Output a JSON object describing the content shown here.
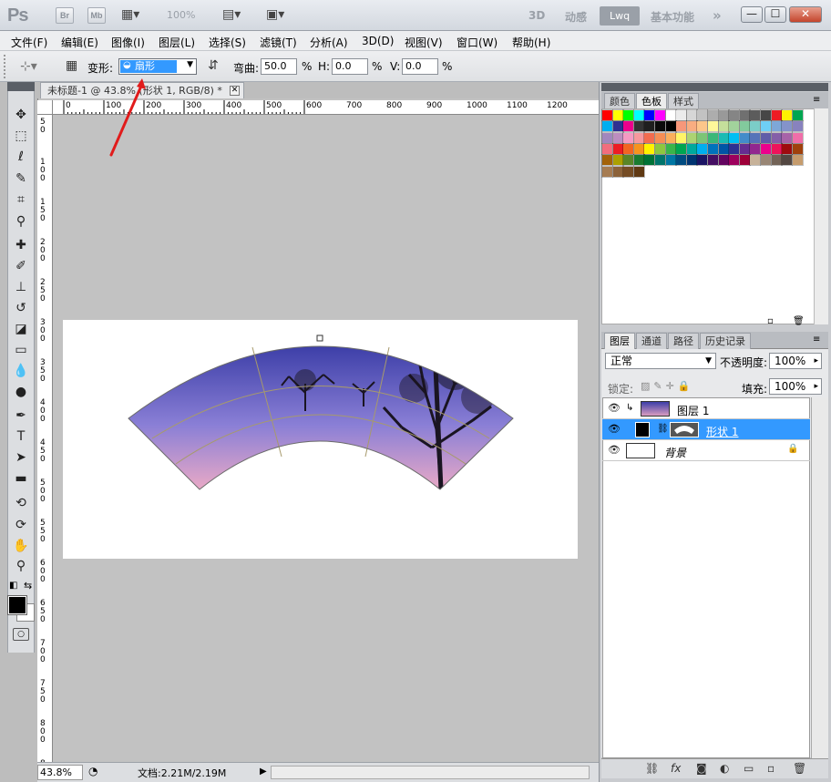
{
  "app": {
    "logo": "Ps",
    "bridge_label": "Br",
    "minibridge_label": "Mb",
    "zoom_text": "100%",
    "workspaces": [
      "3D",
      "动感",
      "Lwq",
      "基本功能"
    ],
    "more_glyph": "»",
    "minimize": "—",
    "maximize": "☐",
    "close": "✕"
  },
  "menu": [
    "文件(F)",
    "编辑(E)",
    "图像(I)",
    "图层(L)",
    "选择(S)",
    "滤镜(T)",
    "分析(A)",
    "3D(D)",
    "视图(V)",
    "窗口(W)",
    "帮助(H)"
  ],
  "options": {
    "warp_label": "变形:",
    "warp_value": "扇形",
    "bend_label": "弯曲:",
    "bend_value": "50.0",
    "bend_unit": "%",
    "h_label": "H:",
    "h_value": "0.0",
    "h_unit": "%",
    "v_label": "V:",
    "v_value": "0.0",
    "v_unit": "%"
  },
  "document": {
    "tab_title": "未标题-1 @ 43.8% (形状 1, RGB/8) *",
    "ruler_h": [
      "0",
      "100",
      "200",
      "300",
      "400",
      "500",
      "600",
      "700",
      "800",
      "900",
      "1000",
      "1100",
      "1200"
    ],
    "ruler_v": [
      "5\n0",
      "1\n0\n0",
      "1\n5\n0",
      "2\n0\n0",
      "2\n5\n0",
      "3\n0\n0",
      "3\n5\n0",
      "4\n0\n0",
      "4\n5\n0",
      "5\n0\n0",
      "5\n5\n0",
      "6\n0\n0",
      "6\n5\n0",
      "7\n0\n0",
      "7\n5\n0",
      "8\n0\n0",
      "8\n5\n0"
    ]
  },
  "status": {
    "zoom": "43.8%",
    "doc_info": "文档:2.21M/2.19M"
  },
  "swatches_panel": {
    "tabs": [
      "颜色",
      "色板",
      "样式"
    ],
    "active_tab": "色板",
    "colors": [
      "#ff0000",
      "#ffff00",
      "#00ff00",
      "#00ffff",
      "#0000ff",
      "#ff00ff",
      "#ffffff",
      "#ebebeb",
      "#d6d6d6",
      "#c2c2c2",
      "#adadad",
      "#999999",
      "#858585",
      "#707070",
      "#5c5c5c",
      "#474747",
      "#ee1c24",
      "#fff200",
      "#00a651",
      "#00aeef",
      "#2e3192",
      "#ec008c",
      "#333333",
      "#1f1f1f",
      "#0a0a0a",
      "#000000",
      "#f7977a",
      "#f9ad81",
      "#fdc68a",
      "#fff79a",
      "#c4df9b",
      "#a2d39c",
      "#82ca9d",
      "#7bcdc8",
      "#6ecff6",
      "#7ea7d8",
      "#8493ca",
      "#8882be",
      "#a187be",
      "#bc8dbf",
      "#f49ac2",
      "#f6989d",
      "#f26c4f",
      "#f68e55",
      "#fbaf5c",
      "#fff467",
      "#acd372",
      "#7cc576",
      "#3bb878",
      "#1abbb4",
      "#00bff3",
      "#438cca",
      "#5574b9",
      "#605ca8",
      "#855fa8",
      "#a763a8",
      "#f06ea9",
      "#f26d7d",
      "#ed1c24",
      "#f26522",
      "#f7941d",
      "#fff200",
      "#8dc73f",
      "#39b54a",
      "#00a651",
      "#00a99d",
      "#00aeef",
      "#0072bc",
      "#0054a6",
      "#2e3192",
      "#662d91",
      "#92278f",
      "#ec008c",
      "#ed145b",
      "#9e0b0f",
      "#a0410d",
      "#a36209",
      "#aba000",
      "#598527",
      "#1a7b30",
      "#007236",
      "#00746b",
      "#0076a3",
      "#004b80",
      "#003471",
      "#1b1464",
      "#440e62",
      "#630460",
      "#9e005d",
      "#9e0039",
      "#c7b299",
      "#998675",
      "#736357",
      "#534741",
      "#c69c6d",
      "#a67c52",
      "#8c6239",
      "#754c24",
      "#603913"
    ]
  },
  "layers_panel": {
    "tabs": [
      "图层",
      "通道",
      "路径",
      "历史记录"
    ],
    "active_tab": "图层",
    "blend_mode": "正常",
    "opacity_label": "不透明度:",
    "opacity_value": "100%",
    "lock_label": "锁定:",
    "fill_label": "填充:",
    "fill_value": "100%",
    "layers": [
      {
        "name": "图层 1",
        "selected": false
      },
      {
        "name": "形状 1",
        "selected": true
      },
      {
        "name": "背景",
        "selected": false
      }
    ]
  },
  "colors": {
    "accent": "#3399ff",
    "selected_row": "#3399ff",
    "annotation_arrow": "#e11b1b"
  }
}
